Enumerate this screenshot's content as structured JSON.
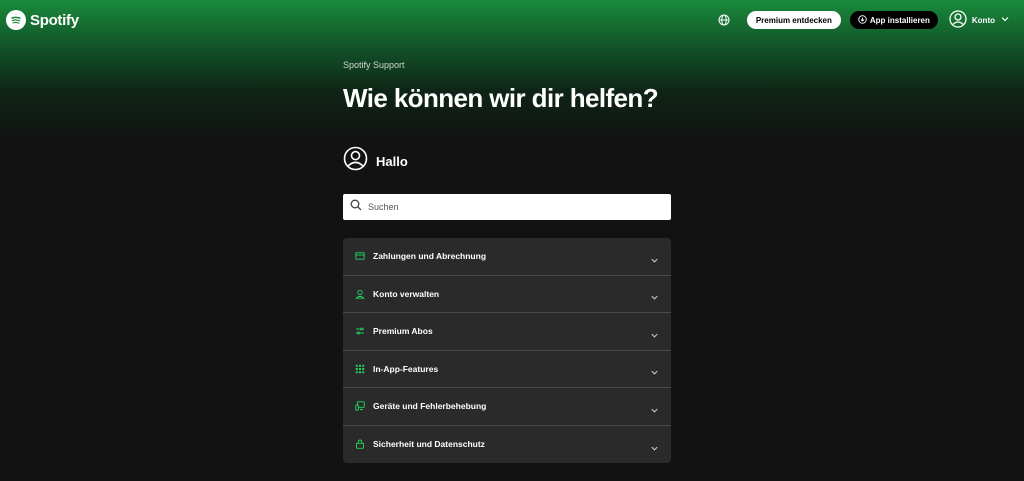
{
  "header": {
    "brand": "Spotify",
    "premium_label": "Premium entdecken",
    "app_label": "App installieren",
    "account_label": "Konto"
  },
  "main": {
    "support_label": "Spotify Support",
    "headline": "Wie können wir dir helfen?",
    "greeting": "Hallo",
    "search_placeholder": "Suchen"
  },
  "categories": [
    {
      "label": "Zahlungen und Abrechnung",
      "icon": "card-icon"
    },
    {
      "label": "Konto verwalten",
      "icon": "user-icon"
    },
    {
      "label": "Premium Abos",
      "icon": "sliders-icon"
    },
    {
      "label": "In-App-Features",
      "icon": "grid-icon"
    },
    {
      "label": "Geräte und Fehlerbehebung",
      "icon": "devices-icon"
    },
    {
      "label": "Sicherheit und Datenschutz",
      "icon": "lock-icon"
    }
  ],
  "colors": {
    "accent": "#1ed760",
    "background": "#121212",
    "panel": "#2a2a2a"
  }
}
